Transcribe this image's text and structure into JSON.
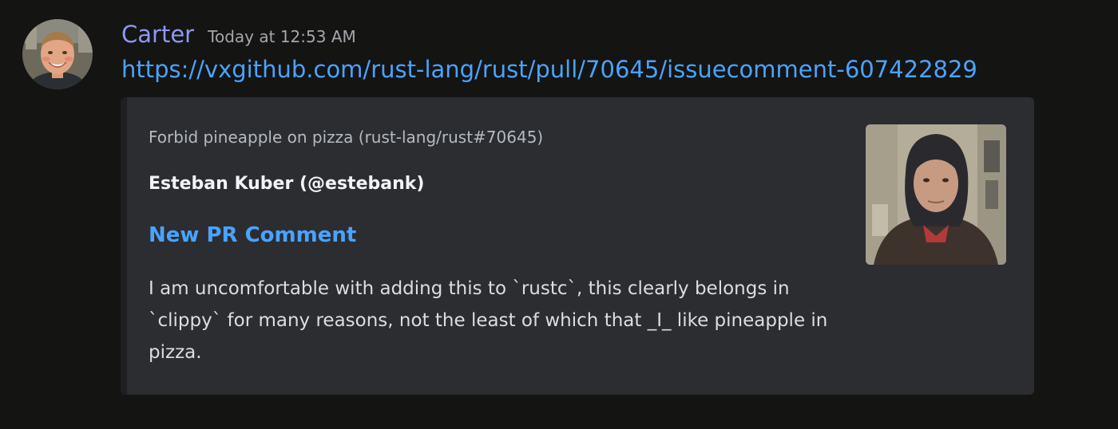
{
  "message": {
    "author": {
      "name": "Carter",
      "name_color": "#8f97f5",
      "avatar_icon": "user-avatar-photo"
    },
    "timestamp": "Today at 12:53 AM",
    "link": "https://vxgithub.com/rust-lang/rust/pull/70645/issuecomment-607422829"
  },
  "embed": {
    "provider": "Forbid pineapple on pizza (rust-lang/rust#70645)",
    "author": "Esteban Kuber (@estebank)",
    "title": "New PR Comment",
    "description": "I am uncomfortable with adding this to `rustc`, this clearly belongs in `clippy` for many reasons, not the least of which that _I_ like pineapple in pizza.",
    "thumbnail_icon": "author-avatar-photo",
    "link_color": "#4aa3ff",
    "background_color": "#2b2d31"
  }
}
